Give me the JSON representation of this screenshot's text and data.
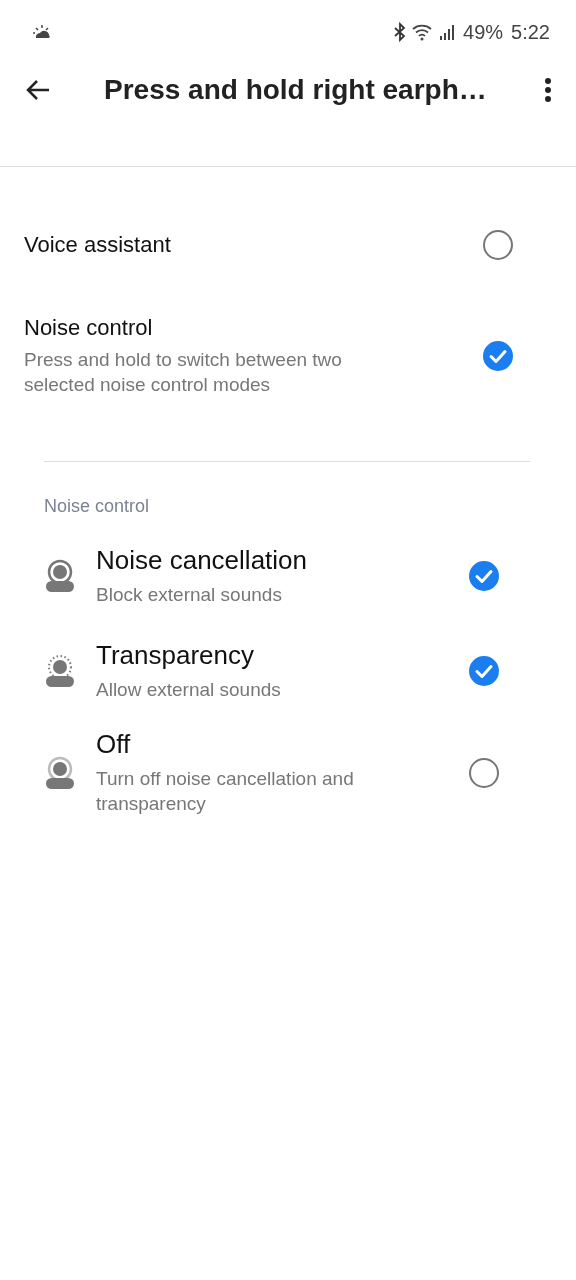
{
  "status_bar": {
    "battery": "49%",
    "time": "5:22"
  },
  "app_bar": {
    "title": "Press and hold right earph…"
  },
  "options": [
    {
      "title": "Voice assistant",
      "checked": false
    },
    {
      "title": "Noise control",
      "subtitle": "Press and hold to switch between two selected noise control modes",
      "checked": true
    }
  ],
  "section": {
    "header": "Noise control",
    "modes": [
      {
        "kind": "cancellation",
        "title": "Noise cancellation",
        "subtitle": "Block external sounds",
        "checked": true
      },
      {
        "kind": "transparency",
        "title": "Transparency",
        "subtitle": "Allow external sounds",
        "checked": true
      },
      {
        "kind": "off",
        "title": "Off",
        "subtitle": "Turn off noise cancellation and transparency",
        "checked": false
      }
    ]
  }
}
